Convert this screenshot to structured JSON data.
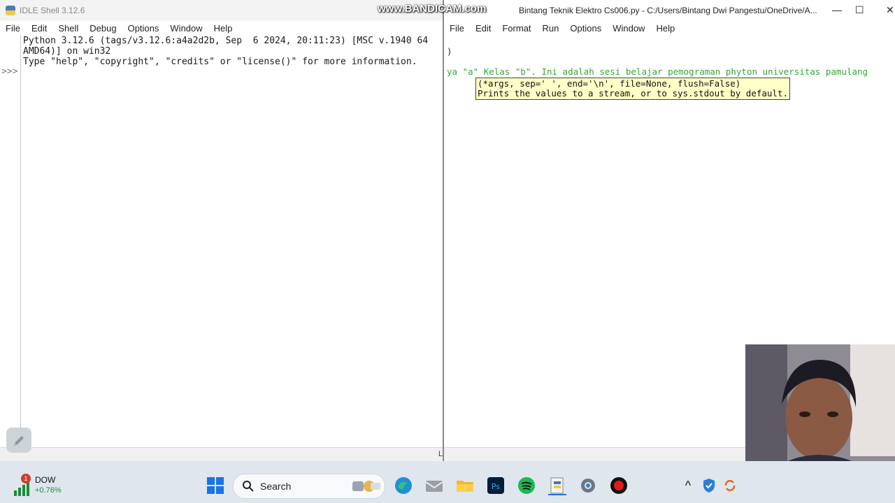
{
  "shell": {
    "title": "IDLE Shell 3.12.6",
    "menu": [
      "File",
      "Edit",
      "Shell",
      "Debug",
      "Options",
      "Window",
      "Help"
    ],
    "lines": [
      "Python 3.12.6 (tags/v3.12.6:a4a2d2b, Sep  6 2024, 20:11:23) [MSC v.1940 64",
      "AMD64)] on win32",
      "Type \"help\", \"copyright\", \"credits\" or \"license()\" for more information."
    ],
    "prompt": ">>>",
    "status_mark": "L"
  },
  "editor": {
    "title": "Bintang Teknik Elektro Cs006.py - C:/Users/Bintang Dwi Pangestu/OneDrive/A...",
    "menu": [
      "File",
      "Edit",
      "Format",
      "Run",
      "Options",
      "Window",
      "Help"
    ],
    "code_paren": ")",
    "code_string": "ya \"a\" Kelas \"b\". Ini adalah sesi belajar pemograman phyton universitas pamulang",
    "calltip_line1": "(*args, sep=' ', end='\\n', file=None, flush=False)",
    "calltip_line2": "Prints the values to a stream, or to sys.stdout by default.",
    "minimize": "—",
    "maximize": "☐",
    "close": "✕"
  },
  "watermark": "www.BANDICAM.com",
  "taskbar": {
    "stock_badge": "1",
    "stock_name": "DOW",
    "stock_change": "+0.76%",
    "search_label": "Search",
    "apps": [
      "windows-start-icon",
      "edge-icon",
      "mail-icon",
      "file-explorer-icon",
      "photoshop-icon",
      "spotify-icon",
      "idle-python-icon",
      "settings-icon",
      "record-icon"
    ],
    "tray_chevron": "^",
    "colors": {
      "stock_up": "#1c8a3a",
      "badge": "#d23b2f",
      "record": "#e21b1b",
      "spotify": "#1db954",
      "photoshop": "#001e36"
    }
  },
  "colors": {
    "string_green": "#3aa33a",
    "calltip_bg": "#ffffc8",
    "taskbar_bg": "#dfe6ee"
  }
}
